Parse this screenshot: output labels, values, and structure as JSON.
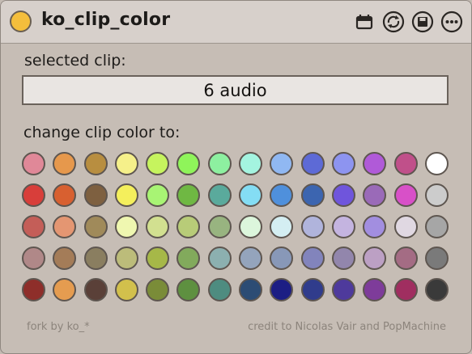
{
  "window": {
    "title": "ko_clip_color",
    "title_dot_color": "#f4be3c",
    "icons": [
      "calendar-icon",
      "refresh-icon",
      "save-icon",
      "more-icon"
    ]
  },
  "selected_clip": {
    "label": "selected clip:",
    "value": "6 audio"
  },
  "palette": {
    "label": "change clip color to:",
    "rows": [
      [
        "#e08898",
        "#e6984c",
        "#b88e40",
        "#f5f08a",
        "#c6f45e",
        "#8ff45a",
        "#8df0a0",
        "#a4f4e0",
        "#90b8f2",
        "#5d6ad6",
        "#8d94f0",
        "#b05ad8",
        "#c0508a",
        "#ffffff"
      ],
      [
        "#d83e3a",
        "#d86030",
        "#7e6040",
        "#f4ef5c",
        "#a8f474",
        "#6fb843",
        "#5aaa9c",
        "#84ddf4",
        "#4f90dc",
        "#3c65b0",
        "#6f55dc",
        "#9a6ab8",
        "#d850c8",
        "#cccccc"
      ],
      [
        "#c45e58",
        "#e49672",
        "#a08a5a",
        "#eff7b0",
        "#d2e090",
        "#b8cc78",
        "#98b480",
        "#dcf6dc",
        "#d4eef2",
        "#b0b4dc",
        "#c4b4e0",
        "#a28ee0",
        "#e0d8e2",
        "#a6a6a6"
      ],
      [
        "#b08888",
        "#a47c58",
        "#8a7e60",
        "#bcbc7a",
        "#a6b848",
        "#82aa5c",
        "#8cb0b0",
        "#94a4bc",
        "#8898b8",
        "#8284bc",
        "#9286ac",
        "#bca0c4",
        "#a46c84",
        "#7a7a7a"
      ],
      [
        "#8e2e2a",
        "#e59c50",
        "#5a4038",
        "#d2c04c",
        "#7a8c38",
        "#5e9040",
        "#4e8c80",
        "#2c4c74",
        "#1c1e84",
        "#303c8c",
        "#4e3a9c",
        "#7e3c9a",
        "#a02e60",
        "#3a3a3a"
      ]
    ]
  },
  "footer": {
    "left": "fork by ko_*",
    "right": "credit to Nicolas Vair and PopMachine"
  }
}
